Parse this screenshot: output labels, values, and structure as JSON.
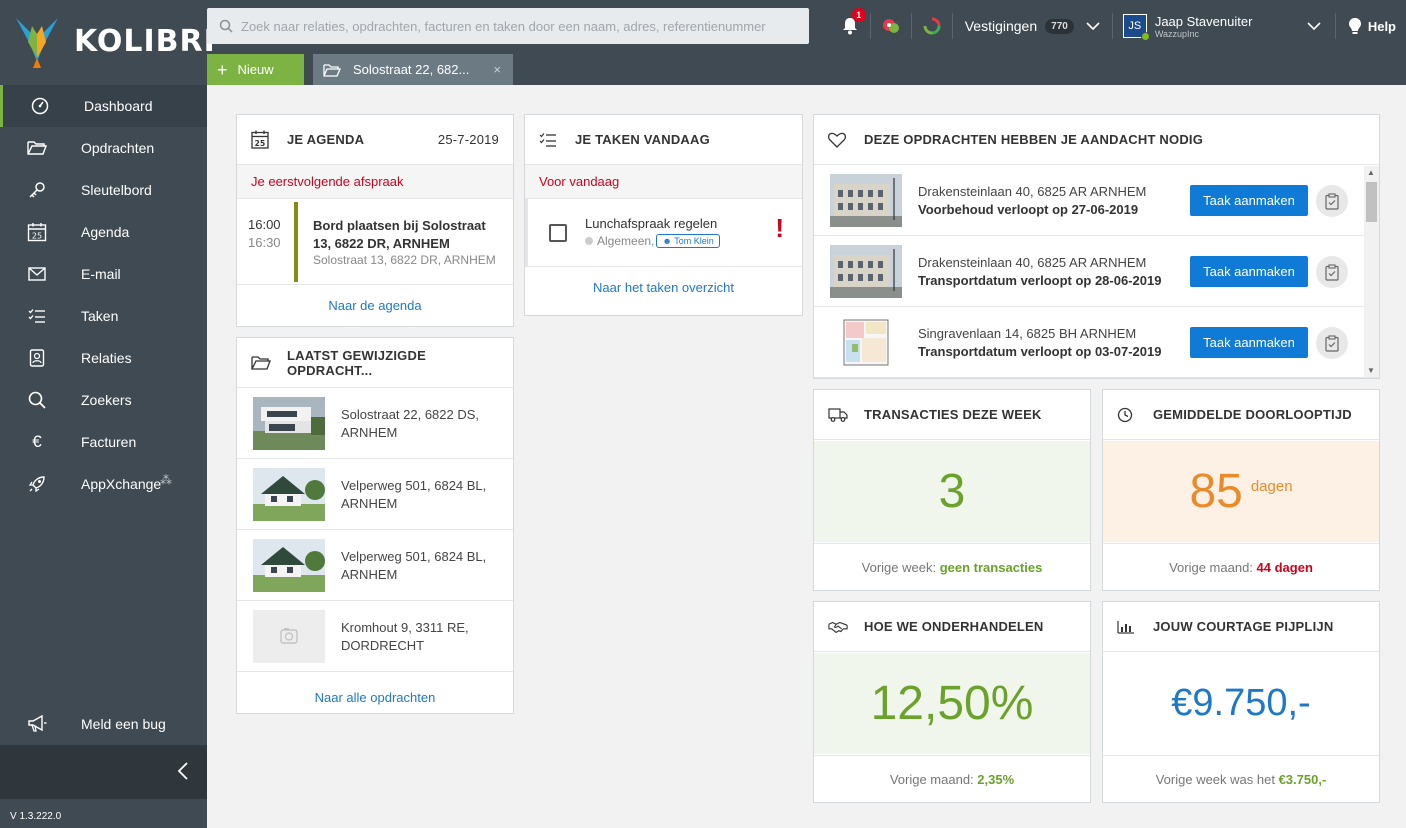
{
  "app": {
    "name": "KOLIBRI",
    "version": "V 1.3.222.0"
  },
  "search": {
    "placeholder": "Zoek naar relaties, opdrachten, facturen en taken door een naam, adres, referentienummer"
  },
  "topbar": {
    "notifications_count": "1",
    "vestigingen_label": "Vestigingen",
    "vestigingen_count": "770",
    "user_initials": "JS",
    "user_name": "Jaap Stavenuiter",
    "user_company": "WazzupInc",
    "help_label": "Help"
  },
  "toolbar": {
    "new_label": "Nieuw",
    "open_tab_label": "Solostraat 22, 682...",
    "close_symbol": "×"
  },
  "sidebar": {
    "items": [
      {
        "label": "Dashboard",
        "icon": "dashboard-icon"
      },
      {
        "label": "Opdrachten",
        "icon": "folder-icon"
      },
      {
        "label": "Sleutelbord",
        "icon": "key-icon"
      },
      {
        "label": "Agenda",
        "icon": "calendar-icon"
      },
      {
        "label": "E-mail",
        "icon": "mail-icon"
      },
      {
        "label": "Taken",
        "icon": "tasks-icon"
      },
      {
        "label": "Relaties",
        "icon": "contacts-icon"
      },
      {
        "label": "Zoekers",
        "icon": "search-icon"
      },
      {
        "label": "Facturen",
        "icon": "euro-icon"
      },
      {
        "label": "AppXchange",
        "icon": "rocket-icon"
      }
    ],
    "bug_label": "Meld een bug",
    "calendar_day": "25"
  },
  "agenda": {
    "title": "Je agenda",
    "date": "25-7-2019",
    "next_label": "Je eerstvolgende afspraak",
    "appointment": {
      "start": "16:00",
      "end": "16:30",
      "title": "Bord plaatsen bij Solostraat 13, 6822 DR, ARNHEM",
      "address": "Solostraat 13, 6822 DR, ARNHEM"
    },
    "link": "Naar de agenda"
  },
  "tasks": {
    "title": "Je taken vandaag",
    "sub_label": "Voor vandaag",
    "task": {
      "title": "Lunchafspraak regelen",
      "category": "Algemeen,",
      "assignee": "Tom Klein",
      "priority_mark": "!"
    },
    "link": "Naar het taken overzicht"
  },
  "recent": {
    "title": "Laatst gewijzigde opdracht...",
    "items": [
      {
        "address": "Solostraat 22, 6822 DS, ARNHEM"
      },
      {
        "address": "Velperweg 501, 6824 BL, ARNHEM"
      },
      {
        "address": "Velperweg 501, 6824 BL, ARNHEM"
      },
      {
        "address": "Kromhout 9, 3311 RE, DORDRECHT"
      }
    ],
    "link": "Naar alle opdrachten"
  },
  "attention": {
    "title": "Deze opdrachten hebben je aandacht nodig",
    "button_label": "Taak aanmaken",
    "items": [
      {
        "address": "Drakensteinlaan 40, 6825 AR ARNHEM",
        "note": "Voorbehoud verloopt op 27-06-2019"
      },
      {
        "address": "Drakensteinlaan 40, 6825 AR ARNHEM",
        "note": "Transportdatum verloopt op 28-06-2019"
      },
      {
        "address": "Singravenlaan 14, 6825 BH ARNHEM",
        "note": "Transportdatum verloopt op 03-07-2019"
      }
    ]
  },
  "kpis": {
    "transactions": {
      "title": "Transacties deze week",
      "value": "3",
      "foot_label": "Vorige week:",
      "foot_value": "geen transacties",
      "color": "#6aa22b",
      "bg": "#f1f6ec"
    },
    "throughput": {
      "title": "Gemiddelde doorlooptijd",
      "value": "85",
      "unit": "dagen",
      "foot_label": "Vorige maand:",
      "foot_value": "44 dagen",
      "color": "#e98b2a",
      "bg": "#fdf1e6"
    },
    "negotiation": {
      "title": "Hoe we onderhandelen",
      "value": "12,50%",
      "foot_label": "Vorige maand:",
      "foot_value": "2,35%",
      "color": "#6aa22b",
      "bg": "#f1f6ec"
    },
    "pipeline": {
      "title": "Jouw courtage pijplijn",
      "value": "€9.750,-",
      "foot_label": "Vorige week was het",
      "foot_value": "€3.750,-",
      "color": "#1e78c8",
      "bg": "#ffffff"
    }
  }
}
